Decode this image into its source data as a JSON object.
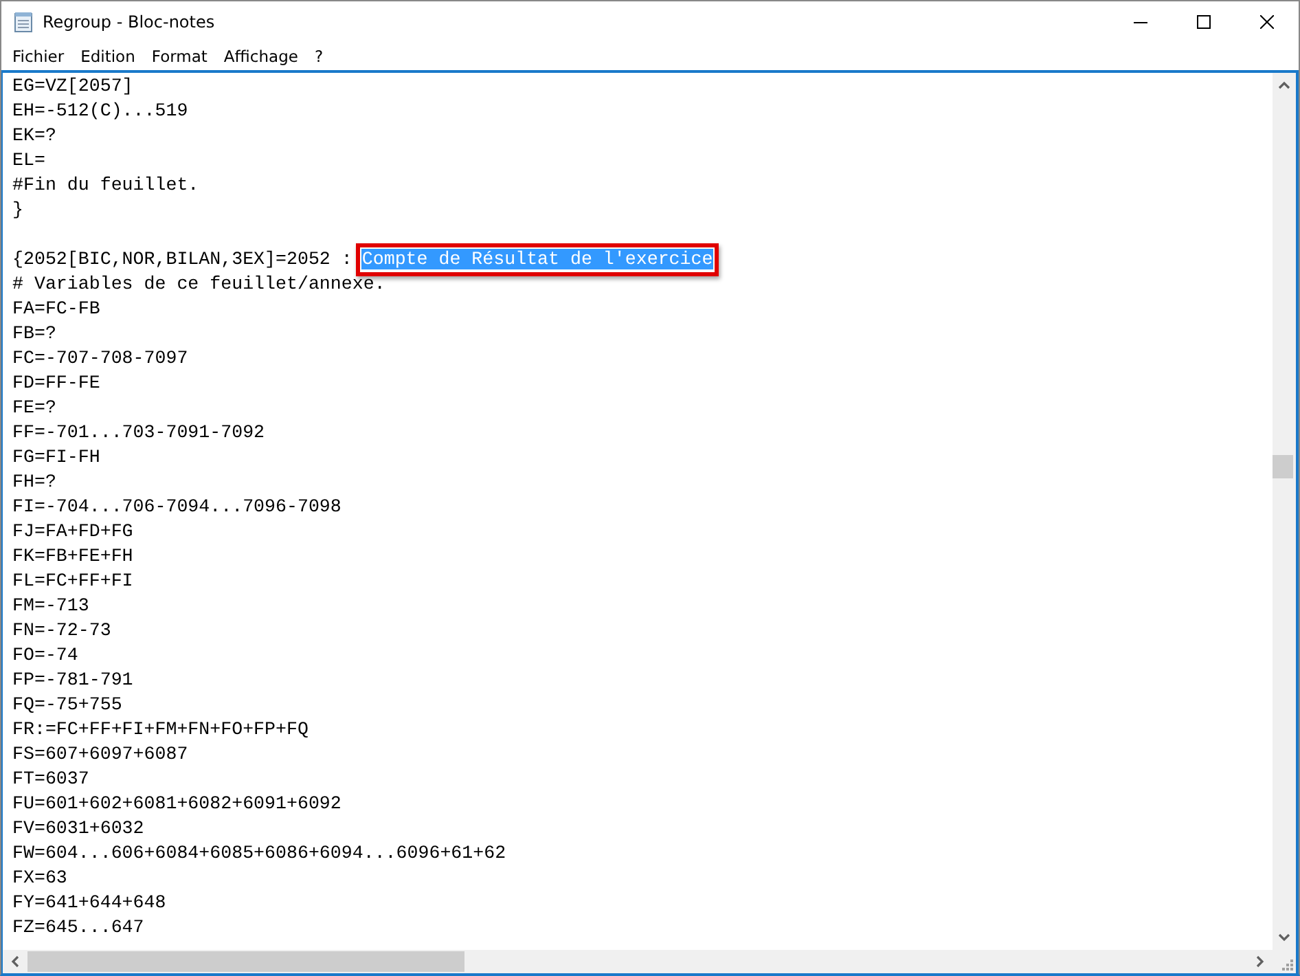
{
  "window": {
    "title": "Regroup - Bloc-notes"
  },
  "menu": [
    "Fichier",
    "Edition",
    "Format",
    "Affichage",
    "?"
  ],
  "lines": [
    {
      "kind": "text",
      "text": "EG=VZ[2057]"
    },
    {
      "kind": "text",
      "text": "EH=-512(C)...519"
    },
    {
      "kind": "text",
      "text": "EK=?"
    },
    {
      "kind": "text",
      "text": "EL="
    },
    {
      "kind": "text",
      "text": "#Fin du feuillet."
    },
    {
      "kind": "text",
      "text": "}"
    },
    {
      "kind": "blank"
    },
    {
      "kind": "selection",
      "text": "{2052[BIC,NOR,BILAN,3EX]=2052 :",
      "selected": "Compte de Résultat de l'exercice",
      "annotated": true
    },
    {
      "kind": "text",
      "text": "# Variables de ce feuillet/annexe."
    },
    {
      "kind": "text",
      "text": "FA=FC-FB"
    },
    {
      "kind": "text",
      "text": "FB=?"
    },
    {
      "kind": "text",
      "text": "FC=-707-708-7097"
    },
    {
      "kind": "text",
      "text": "FD=FF-FE"
    },
    {
      "kind": "text",
      "text": "FE=?"
    },
    {
      "kind": "text",
      "text": "FF=-701...703-7091-7092"
    },
    {
      "kind": "text",
      "text": "FG=FI-FH"
    },
    {
      "kind": "text",
      "text": "FH=?"
    },
    {
      "kind": "text",
      "text": "FI=-704...706-7094...7096-7098"
    },
    {
      "kind": "text",
      "text": "FJ=FA+FD+FG"
    },
    {
      "kind": "text",
      "text": "FK=FB+FE+FH"
    },
    {
      "kind": "text",
      "text": "FL=FC+FF+FI"
    },
    {
      "kind": "text",
      "text": "FM=-713"
    },
    {
      "kind": "text",
      "text": "FN=-72-73"
    },
    {
      "kind": "text",
      "text": "FO=-74"
    },
    {
      "kind": "text",
      "text": "FP=-781-791"
    },
    {
      "kind": "text",
      "text": "FQ=-75+755"
    },
    {
      "kind": "text",
      "text": "FR:=FC+FF+FI+FM+FN+FO+FP+FQ"
    },
    {
      "kind": "text",
      "text": "FS=607+6097+6087"
    },
    {
      "kind": "text",
      "text": "FT=6037"
    },
    {
      "kind": "text",
      "text": "FU=601+602+6081+6082+6091+6092"
    },
    {
      "kind": "text",
      "text": "FV=6031+6032"
    },
    {
      "kind": "text",
      "text": "FW=604...606+6084+6085+6086+6094...6096+61+62"
    },
    {
      "kind": "text",
      "text": "FX=63"
    },
    {
      "kind": "text",
      "text": "FY=641+644+648"
    },
    {
      "kind": "text",
      "text": "FZ=645...647"
    }
  ]
}
